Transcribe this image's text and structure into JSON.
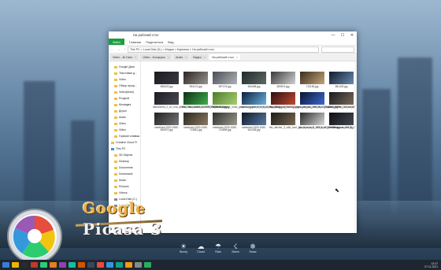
{
  "window": {
    "title": "На рабочий стол",
    "controls": [
      "—",
      "☐",
      "✕"
    ]
  },
  "ribbon": {
    "file_label": "Файл",
    "tabs": [
      "Главная",
      "Поделиться",
      "Вид"
    ]
  },
  "address": {
    "path": "This PC  >  Local Disk (D:)  >  Медиа  >  Картинки  >  На рабочий стол"
  },
  "tabs": [
    {
      "label": "Video - 4k Нато"
    },
    {
      "label": "Video - Концерты"
    },
    {
      "label": "Audio"
    },
    {
      "label": "Видео"
    },
    {
      "label": "На рабочий стол"
    }
  ],
  "sidebar": {
    "items": [
      {
        "label": "Google Диск",
        "indent": true,
        "icon": "folder-icon"
      },
      {
        "label": "Текстовые д...",
        "indent": true,
        "icon": "folder-icon"
      },
      {
        "label": "Video",
        "indent": true,
        "icon": "folder-icon"
      },
      {
        "label": "Обзор прогр...",
        "indent": true,
        "icon": "folder-icon"
      },
      {
        "label": "Video(Mobi)",
        "indent": true,
        "icon": "folder-icon"
      },
      {
        "label": "Progectt",
        "indent": true,
        "icon": "folder-icon"
      },
      {
        "label": "Montages",
        "indent": true,
        "icon": "folder-icon"
      },
      {
        "label": "Доуоп",
        "indent": true,
        "icon": "folder-icon"
      },
      {
        "label": "Audio",
        "indent": true,
        "icon": "folder-icon"
      },
      {
        "label": "Video",
        "indent": true,
        "icon": "folder-icon"
      },
      {
        "label": "Video",
        "indent": true,
        "icon": "folder-icon"
      },
      {
        "label": "Горячие клавиш",
        "indent": true,
        "icon": "folder-icon"
      },
      {
        "label": "Creative Cloud Fi",
        "indent": false,
        "icon": "folder-icon"
      },
      {
        "label": "This PC",
        "indent": false,
        "icon": "computer-icon"
      },
      {
        "label": "3D Objects",
        "indent": true,
        "icon": "folder-icon"
      },
      {
        "label": "Desktop",
        "indent": true,
        "icon": "folder-icon"
      },
      {
        "label": "Documents",
        "indent": true,
        "icon": "folder-icon"
      },
      {
        "label": "Downloads",
        "indent": true,
        "icon": "folder-icon"
      },
      {
        "label": "Music",
        "indent": true,
        "icon": "folder-icon"
      },
      {
        "label": "Pictures",
        "indent": true,
        "icon": "folder-icon"
      },
      {
        "label": "Videos",
        "indent": true,
        "icon": "folder-icon"
      },
      {
        "label": "Local Disk (C:)",
        "indent": true,
        "icon": "drive-icon"
      },
      {
        "label": "Local Disk (D:)",
        "indent": true,
        "icon": "drive-icon"
      }
    ]
  },
  "files": [
    {
      "name": "585023.jpg",
      "colors": [
        "#1a1a1e",
        "#3a3a42"
      ]
    },
    {
      "name": "594121.jpg",
      "colors": [
        "#2a2622",
        "#9a9490"
      ]
    },
    {
      "name": "597191.jpg",
      "colors": [
        "#4a4e55",
        "#b0b2b5"
      ]
    },
    {
      "name": "606458.jpg",
      "colors": [
        "#1f2a2d",
        "#606a64"
      ]
    },
    {
      "name": "653874.jpg",
      "colors": [
        "#3a3a3a",
        "#d0d0d0"
      ]
    },
    {
      "name": "710183.jpg",
      "colors": [
        "#3b2b1e",
        "#c3a67a"
      ]
    },
    {
      "name": "581433.jpg",
      "colors": [
        "#101c2a",
        "#6a8ab0"
      ]
    },
    {
      "name": "dishonored_2_bv_nna_attano_blac_mashi_112407_19_20x1080.jpg",
      "colors": [
        "#1a1c22",
        "#4a4a52"
      ]
    },
    {
      "name": "f5e87f84a4e0f00d1240f60788f66d1a.jpg",
      "colors": [
        "#0e3015",
        "#3fae4b"
      ]
    },
    {
      "name": "minecraft_backgr_ound_graphics_game_21594_1920x1080.jpg",
      "colors": [
        "#4d7a2c",
        "#a8d070"
      ]
    },
    {
      "name": "minecraft_planet_s_mon_holo_2220_1920x1080.jpg",
      "colors": [
        "#0a1e3c",
        "#6ab0e0"
      ]
    },
    {
      "name": "my_mass_sky_hello_games_pst_play_98930_1920x1080.jpg",
      "colors": [
        "#2a0e14",
        "#c04a30"
      ]
    },
    {
      "name": "playstation_emu_lator_playdar_22096_1920x1080.jpg",
      "colors": [
        "#0a1430",
        "#3d6ad0"
      ]
    },
    {
      "name": "street_fighter_vn_ew_character_sol_playstation_4_22099_1920x1080.jpg",
      "colors": [
        "#161a22",
        "#7a6a58"
      ]
    },
    {
      "name": "stretched-1920-1080-650874.jpg",
      "colors": [
        "#202020",
        "#777777"
      ]
    },
    {
      "name": "stretched-1920-1080-713861.jpg",
      "colors": [
        "#2a2620",
        "#8a7a60"
      ]
    },
    {
      "name": "stretched-1920-1080-724896.jpg",
      "colors": [
        "#30302c",
        "#9a9a8e"
      ]
    },
    {
      "name": "stretched-1920-1080-641435.jpg",
      "colors": [
        "#101a28",
        "#5a7aa0"
      ]
    },
    {
      "name": "the_witcher_3_wild_hunt_geralt_of_rivia_70741_1920x1080.jpg",
      "colors": [
        "#1c1a18",
        "#7a6a55"
      ]
    },
    {
      "name": "the_witcher_3_wild_hunt_personna_non_28175_1920x1080.jpg",
      "colors": [
        "#2a2a2a",
        "#d8d8d8"
      ]
    },
    {
      "name": "Рабочий rabochii.jpg",
      "colors": [
        "#0e0e12",
        "#444a55"
      ]
    }
  ],
  "dock": [
    {
      "label": "Sunny",
      "icon": "sun-icon"
    },
    {
      "label": "Cloud",
      "icon": "cloud-icon"
    },
    {
      "label": "Rain",
      "icon": "rain-icon"
    },
    {
      "label": "Storm",
      "icon": "storm-icon"
    },
    {
      "label": "Snow",
      "icon": "snow-icon"
    }
  ],
  "clock": {
    "time": "13:47",
    "date": "07.11.2021"
  },
  "brand": {
    "line1": "Google",
    "line2": "Picasa 3"
  },
  "taskbar_colors": [
    "#3a7bd5",
    "#f0b400",
    "#2a2a2a",
    "#c0392b",
    "#2ecc71",
    "#e67e22",
    "#8e44ad",
    "#1abc9c",
    "#d35400",
    "#34495e",
    "#e74c3c",
    "#3498db",
    "#16a085",
    "#f39c12",
    "#7f8c8d",
    "#27ae60"
  ]
}
